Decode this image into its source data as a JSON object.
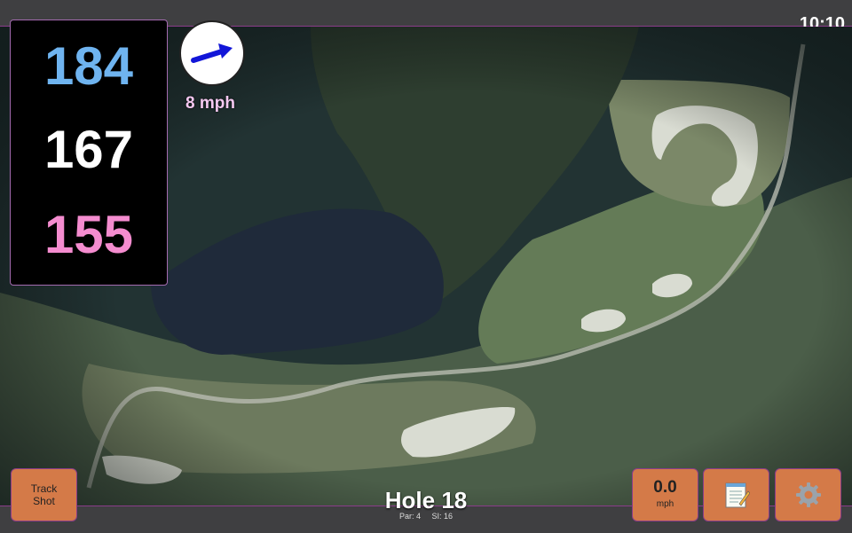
{
  "clock": "10:10",
  "distances": {
    "back": "184",
    "middle": "167",
    "front": "155"
  },
  "wind": {
    "speed": "8 mph",
    "icon": "wind-arrow-icon"
  },
  "hole": {
    "title": "Hole 18",
    "par": "Par: 4",
    "si": "SI: 16"
  },
  "buttons": {
    "track_shot": "Track\nShot",
    "speed_value": "0.0",
    "speed_unit": "mph",
    "notes_icon": "notepad-icon",
    "settings_icon": "gear-icon"
  },
  "colors": {
    "back": "#6fb4f0",
    "middle": "#ffffff",
    "front": "#f48ccf",
    "button": "#d47a48",
    "accent_border": "#8a3c8a"
  }
}
